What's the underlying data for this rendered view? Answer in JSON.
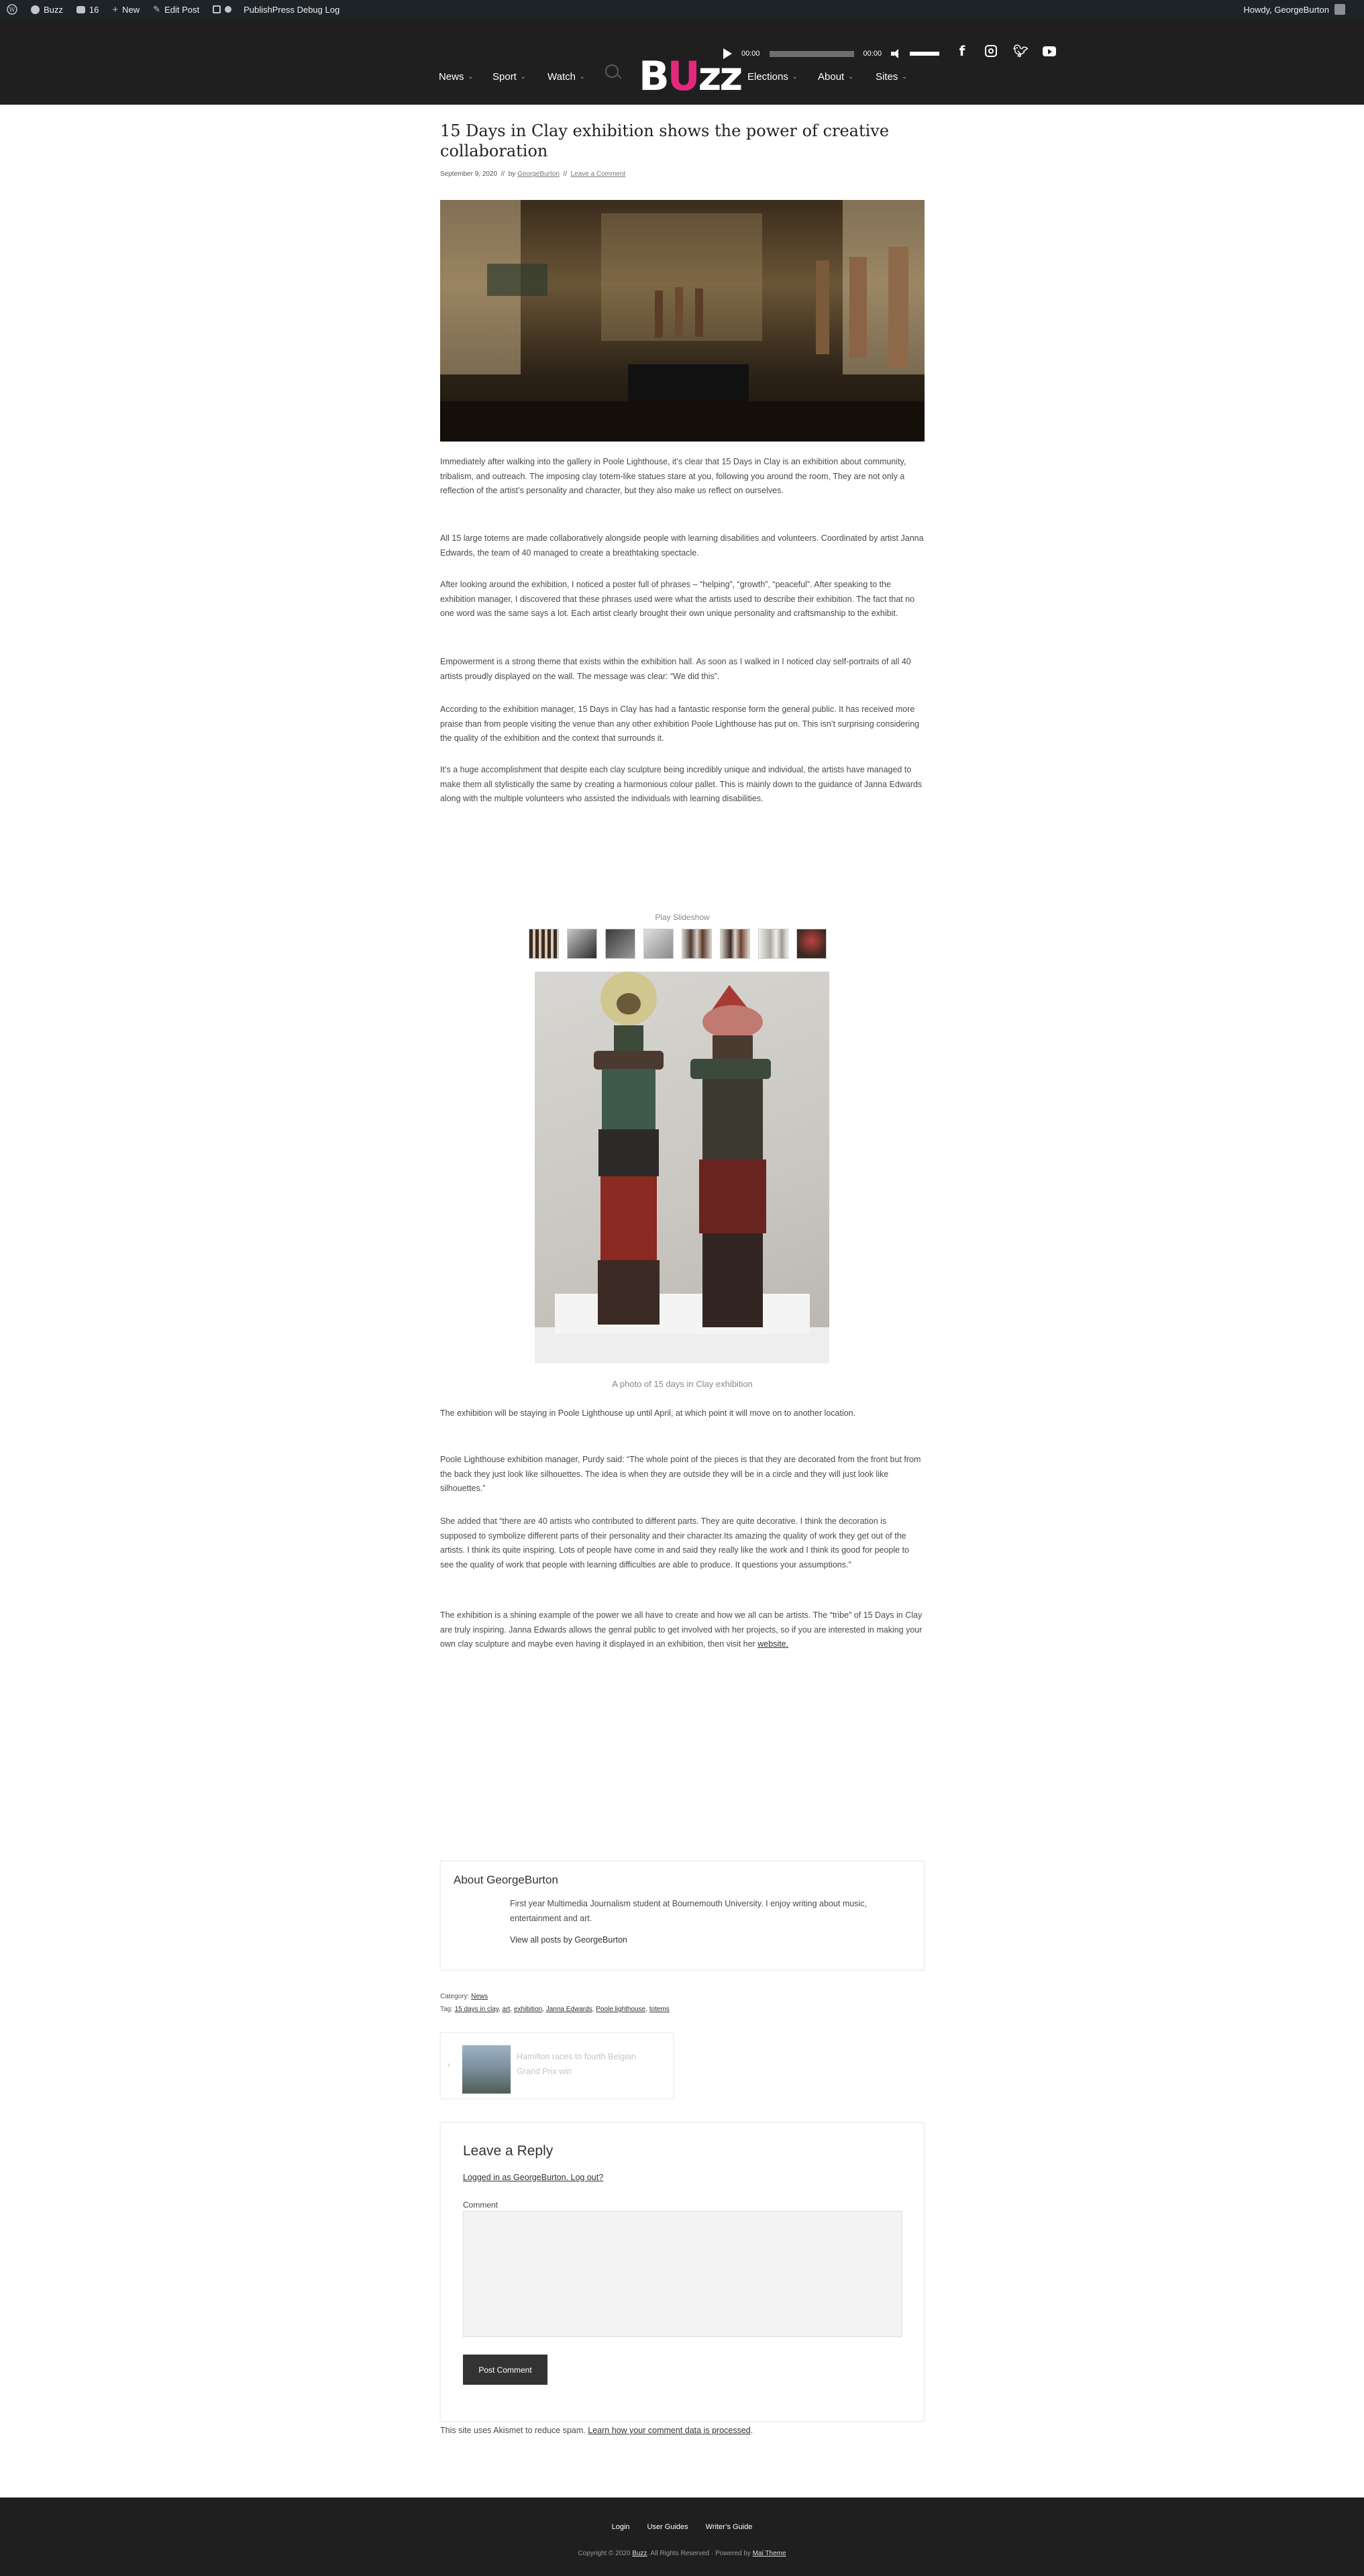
{
  "admin_bar": {
    "site": "Buzz",
    "comments_count": "16",
    "new_label": "New",
    "edit_label": "Edit Post",
    "debug_label": "PublishPress Debug Log",
    "howdy": "Howdy, GeorgeBurton"
  },
  "header": {
    "player": {
      "time_current": "00:00",
      "time_total": "00:00"
    },
    "social": [
      "facebook-icon",
      "instagram-icon",
      "twitter-icon",
      "youtube-icon"
    ],
    "logo": {
      "part1": "B",
      "part2": "U",
      "part3": "zz",
      "accent": "#e6287c"
    },
    "nav_left": [
      "News",
      "Sport",
      "Watch"
    ],
    "nav_right": [
      "Elections",
      "About",
      "Sites"
    ]
  },
  "article": {
    "title": "15 Days in Clay exhibition shows the power of creative collaboration",
    "date": "September 9, 2020",
    "by_label": "by",
    "author": "GeorgeBurton",
    "comment_link": "Leave a Comment",
    "paragraphs": [
      "Immediately after walking into the gallery in Poole Lighthouse, it’s clear that 15 Days in Clay is an exhibition about community, tribalism, and outreach. The imposing clay totem-like statues stare at you, following you around the room, They are not only a reflection of the artist’s personality and character, but they also make us reflect on ourselves.",
      "All 15 large totems are made collaboratively alongside people with learning disabilities and volunteers. Coordinated by artist Janna Edwards, the team of 40 managed to create a breathtaking spectacle.",
      "After looking around the exhibition, I noticed a poster full of phrases – “helping”, “growth”, “peaceful”. After speaking to the exhibition manager, I discovered that these phrases used were what the artists used to describe their exhibition. The fact that no one word was the same says a lot. Each artist clearly brought their own unique personality and craftsmanship to the exhibit.",
      "Empowerment is a strong theme that exists within the exhibition hall. As soon as I walked in I noticed clay self-portraits of all 40 artists proudly displayed on the wall. The message was clear: “We did this”.",
      "According to the exhibition manager, 15 Days in Clay has had a fantastic response form the general public. It has received more praise than from people visiting the venue than any other exhibition Poole Lighthouse has put on. This isn’t surprising considering the quality of the exhibition and the context that surrounds it.",
      "It’s a huge accomplishment that despite each clay sculpture being incredibly unique and individual, the artists have managed to make them all stylistically the same by creating a harmonious colour pallet. This is mainly down to the guidance of Janna Edwards along with the multiple volunteers who assisted the individuals with learning disabilities."
    ],
    "slideshow_label": "Play Slideshow",
    "caption": "A photo of 15 days in Clay exhibition",
    "paragraphs2": [
      "The exhibition will be staying in Poole Lighthouse up until April, at which point it will move on to another location.",
      "Poole Lighthouse exhibition manager, Purdy said: “The whole point of the pieces is that they are decorated from the front but from the back they just look like silhouettes. The idea is when they are outside they will be in a circle and they will just look like silhouettes.”",
      "She added that “there are 40 artists who contributed to different parts. They are quite decorative. I think the decoration is supposed to symbolize different parts of their personality and their character.Its amazing the quality of work they get out of the artists. I think its quite inspiring. Lots of people have come in and said they really like the work and I think its good for people to see the quality of work that people with learning difficulties are able to produce. It questions your assumptions.”",
      "The exhibition is a shining example of the power we all have to create and how we all can be artists. The “tribe” of 15 Days in Clay are truly inspiring. Janna Edwards allows the genral public to get involved with her projects, so if you are interested in making your own clay sculpture and maybe even having it displayed in an exhibition, then visit her"
    ],
    "website_link": "website."
  },
  "author_box": {
    "title": "About GeorgeBurton",
    "bio": "First year Multimedia Journalism student at Bournemouth University. I enjoy writing about music, entertainment and art.",
    "link": "View all posts by GeorgeBurton"
  },
  "taxonomy": {
    "category_label": "Category:",
    "category": "News",
    "tag_label": "Tag:",
    "tags": [
      "15 days in clay",
      "art",
      "exhibition",
      "Janna Edwards",
      "Poole lighthouse",
      "totems"
    ]
  },
  "post_nav": {
    "prev_title": "Hamilton races to fourth Belgian Grand Prix win"
  },
  "reply": {
    "title": "Leave a Reply",
    "logged_in": "Logged in as GeorgeBurton. Log out?",
    "comment_label": "Comment",
    "submit": "Post Comment",
    "akismet_text": "This site uses Akismet to reduce spam.",
    "akismet_link": "Learn how your comment data is processed",
    "akismet_end": "."
  },
  "footer": {
    "links": [
      "Login",
      "User Guides",
      "Writer’s Guide"
    ],
    "copyright": "Copyright © 2020",
    "brand": "Buzz",
    "rights": ". All Rights Reserved · Powered by",
    "theme": "Mai Theme"
  }
}
